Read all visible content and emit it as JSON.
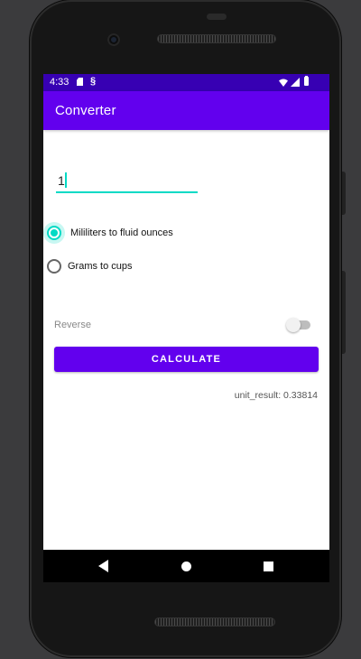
{
  "status_bar": {
    "time": "4:33",
    "icons": [
      "sd-card-icon",
      "s-icon",
      "wifi-icon",
      "signal-icon",
      "battery-icon"
    ],
    "background": "#3700b3"
  },
  "app_bar": {
    "title": "Converter",
    "background": "#6200ee"
  },
  "input": {
    "value": "1",
    "accent": "#03dac5"
  },
  "radio_group": {
    "options": [
      {
        "label": "Mililiters to fluid ounces",
        "checked": true
      },
      {
        "label": "Grams to cups",
        "checked": false
      }
    ]
  },
  "reverse": {
    "label": "Reverse",
    "enabled": false
  },
  "calculate_button": {
    "label": "CALCULATE"
  },
  "result": {
    "text": "unit_result: 0.33814"
  },
  "nav_bar": {
    "icons": [
      "back-icon",
      "home-icon",
      "recents-icon"
    ]
  }
}
